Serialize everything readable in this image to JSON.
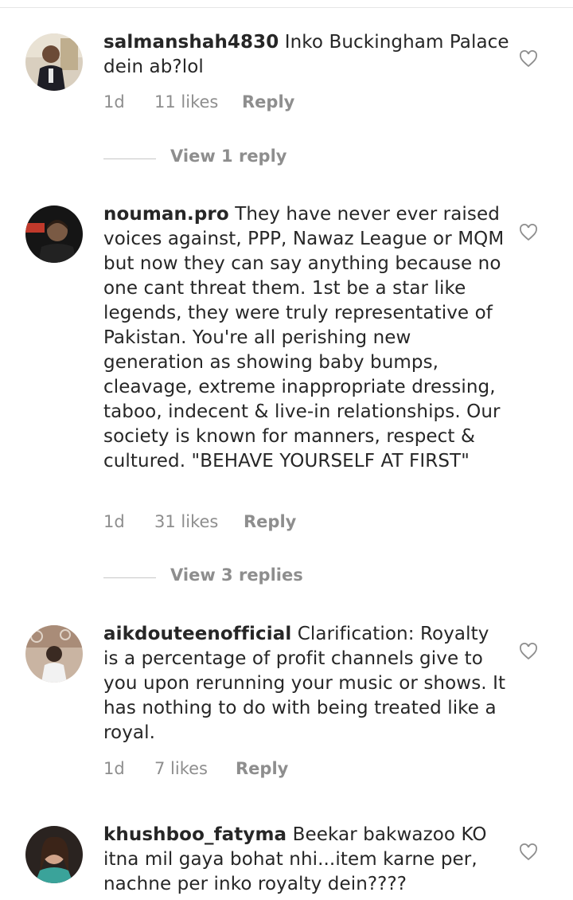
{
  "comments": [
    {
      "username": "salmanshah4830",
      "text": "Inko Buckingham Palace dein ab?lol",
      "time": "1d",
      "likes": "11 likes",
      "reply_label": "Reply",
      "view_replies": "View 1 reply",
      "avatar_icon": "user-avatar",
      "like_icon": "heart-outline-icon"
    },
    {
      "username": "nouman.pro",
      "text": "They have never ever raised voices against, PPP, Nawaz League or MQM but now they can say anything because no one cant threat them. 1st be a star like legends, they were truly representative of Pakistan. You're all perishing new generation as showing baby bumps, cleavage, extreme inappropriate dressing, taboo, indecent & live-in relationships. Our society is known for manners, respect & cultured. \"BEHAVE YOURSELF AT FIRST\"",
      "time": "1d",
      "likes": "31 likes",
      "reply_label": "Reply",
      "view_replies": "View 3 replies",
      "avatar_icon": "user-avatar",
      "like_icon": "heart-outline-icon"
    },
    {
      "username": "aikdouteenofficial",
      "text": "Clarification: Royalty is a percentage of profit channels give to you upon rerunning your music or shows. It has nothing to do with being treated like a royal.",
      "time": "1d",
      "likes": "7 likes",
      "reply_label": "Reply",
      "avatar_icon": "user-avatar",
      "like_icon": "heart-outline-icon"
    },
    {
      "username": "khushboo_fatyma",
      "text": "Beekar bakwazoo KO itna mil gaya bohat nhi...item karne per, nachne per inko royalty dein????",
      "avatar_icon": "user-avatar",
      "like_icon": "heart-outline-icon"
    }
  ],
  "colors": {
    "text": "#262626",
    "meta": "#8e8e8e",
    "divider": "#c7c7c7",
    "background": "#ffffff"
  }
}
